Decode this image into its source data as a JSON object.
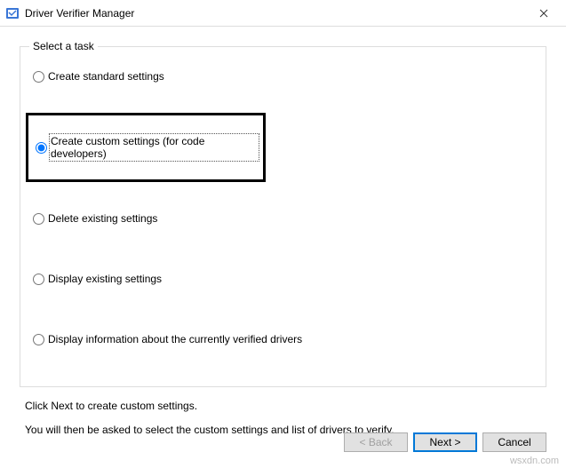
{
  "window": {
    "title": "Driver Verifier Manager"
  },
  "groupbox": {
    "legend": "Select a task"
  },
  "options": {
    "o1": "Create standard settings",
    "o2": "Create custom settings (for code developers)",
    "o3": "Delete existing settings",
    "o4": "Display existing settings",
    "o5": "Display information about the currently verified drivers"
  },
  "instructions": {
    "line1": "Click Next to create custom settings.",
    "line2": "You will then be asked to select the custom settings and list of drivers to verify."
  },
  "buttons": {
    "back": "< Back",
    "next": "Next >",
    "cancel": "Cancel"
  },
  "watermark": "wsxdn.com"
}
